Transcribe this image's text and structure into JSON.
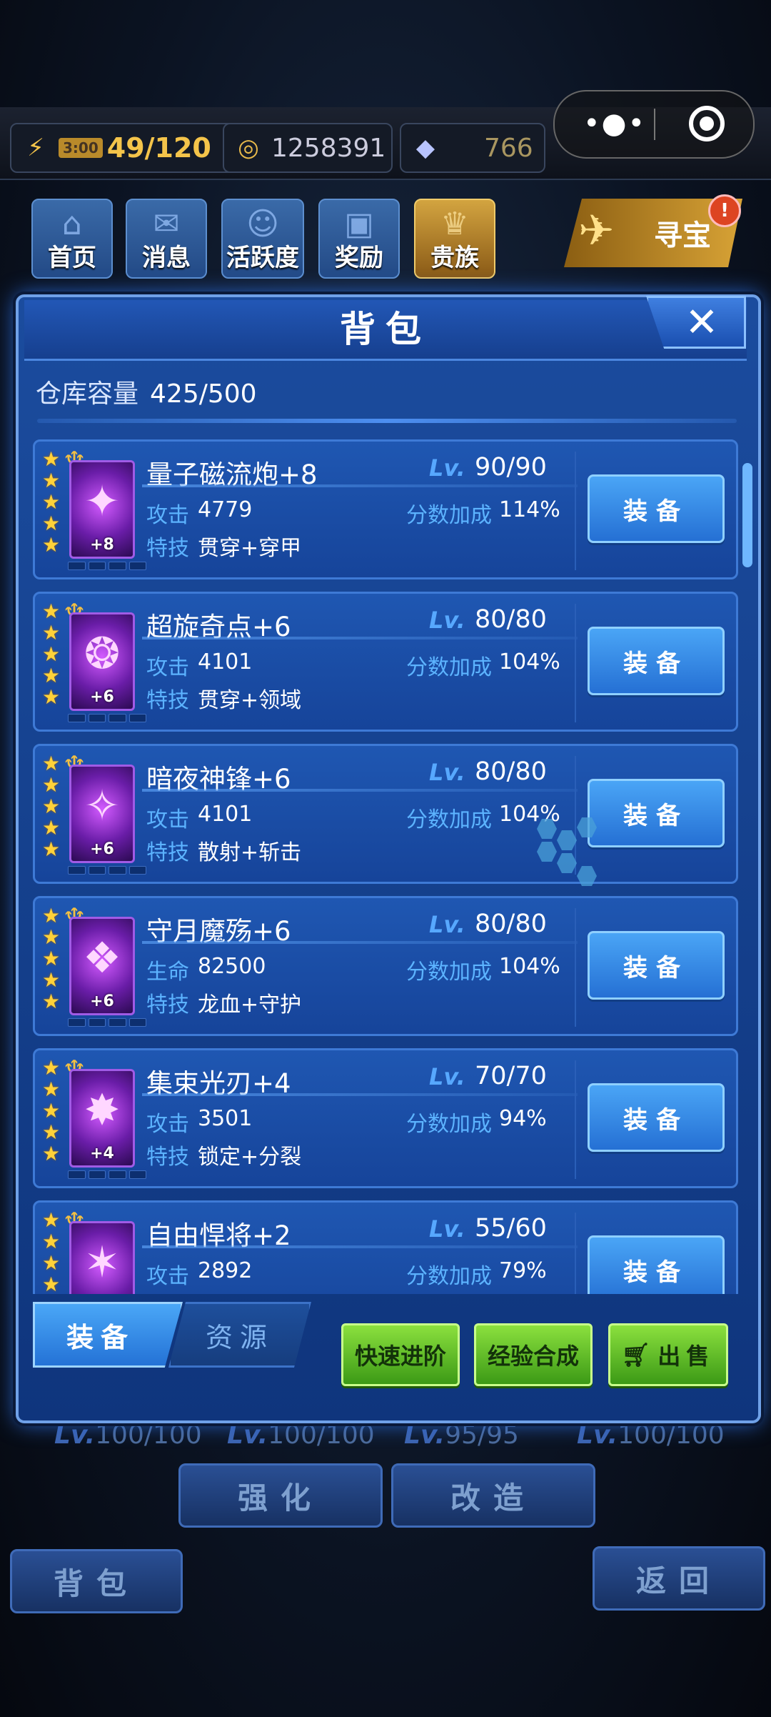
{
  "top": {
    "energy_timer": "3:00",
    "energy": "49/120",
    "coins": "1258391",
    "gems": "766"
  },
  "nav": [
    {
      "label": "首页",
      "icon": "home-icon"
    },
    {
      "label": "消息",
      "icon": "mail-icon"
    },
    {
      "label": "活跃度",
      "icon": "activity-icon"
    },
    {
      "label": "奖励",
      "icon": "gift-icon"
    },
    {
      "label": "贵族",
      "icon": "noble-icon"
    }
  ],
  "treasure_label": "寻宝",
  "treasure_badge": "!",
  "panel": {
    "title": "背包",
    "close_glyph": "✕",
    "capacity_label": "仓库容量",
    "capacity_value": "425/500"
  },
  "items": [
    {
      "name": "量子磁流炮+8",
      "lv_tag": "Lv.",
      "level": "90/90",
      "stat_label": "攻击",
      "stat_value": "4779",
      "bonus_label": "分数加成",
      "bonus_value": "114%",
      "skill_label": "特技",
      "skill_value": "贯穿+穿甲",
      "plus": "+8",
      "stars": 5,
      "button": "装备"
    },
    {
      "name": "超旋奇点+6",
      "lv_tag": "Lv.",
      "level": "80/80",
      "stat_label": "攻击",
      "stat_value": "4101",
      "bonus_label": "分数加成",
      "bonus_value": "104%",
      "skill_label": "特技",
      "skill_value": "贯穿+领域",
      "plus": "+6",
      "stars": 5,
      "button": "装备"
    },
    {
      "name": "暗夜神锋+6",
      "lv_tag": "Lv.",
      "level": "80/80",
      "stat_label": "攻击",
      "stat_value": "4101",
      "bonus_label": "分数加成",
      "bonus_value": "104%",
      "skill_label": "特技",
      "skill_value": "散射+斩击",
      "plus": "+6",
      "stars": 5,
      "button": "装备"
    },
    {
      "name": "守月魔殇+6",
      "lv_tag": "Lv.",
      "level": "80/80",
      "stat_label": "生命",
      "stat_value": "82500",
      "bonus_label": "分数加成",
      "bonus_value": "104%",
      "skill_label": "特技",
      "skill_value": "龙血+守护",
      "plus": "+6",
      "stars": 5,
      "button": "装备"
    },
    {
      "name": "集束光刃+4",
      "lv_tag": "Lv.",
      "level": "70/70",
      "stat_label": "攻击",
      "stat_value": "3501",
      "bonus_label": "分数加成",
      "bonus_value": "94%",
      "skill_label": "特技",
      "skill_value": "锁定+分裂",
      "plus": "+4",
      "stars": 5,
      "button": "装备"
    },
    {
      "name": "自由悍将+2",
      "lv_tag": "Lv.",
      "level": "55/60",
      "stat_label": "攻击",
      "stat_value": "2892",
      "bonus_label": "分数加成",
      "bonus_value": "79%",
      "skill_label": "特技",
      "skill_value": "",
      "plus": "",
      "stars": 5,
      "button": "装备"
    }
  ],
  "tabs": {
    "equip": "装备",
    "resource": "资源"
  },
  "actions": {
    "fast_upgrade": "快速进阶",
    "exp_merge": "经验合成",
    "sell": "出售"
  },
  "behind": {
    "lv_tag": "Lv.",
    "levels": [
      "100/100",
      "100/100",
      "95/95",
      "100/100"
    ],
    "strengthen": "强化",
    "modify": "改造",
    "bag": "背包",
    "back": "返回"
  }
}
